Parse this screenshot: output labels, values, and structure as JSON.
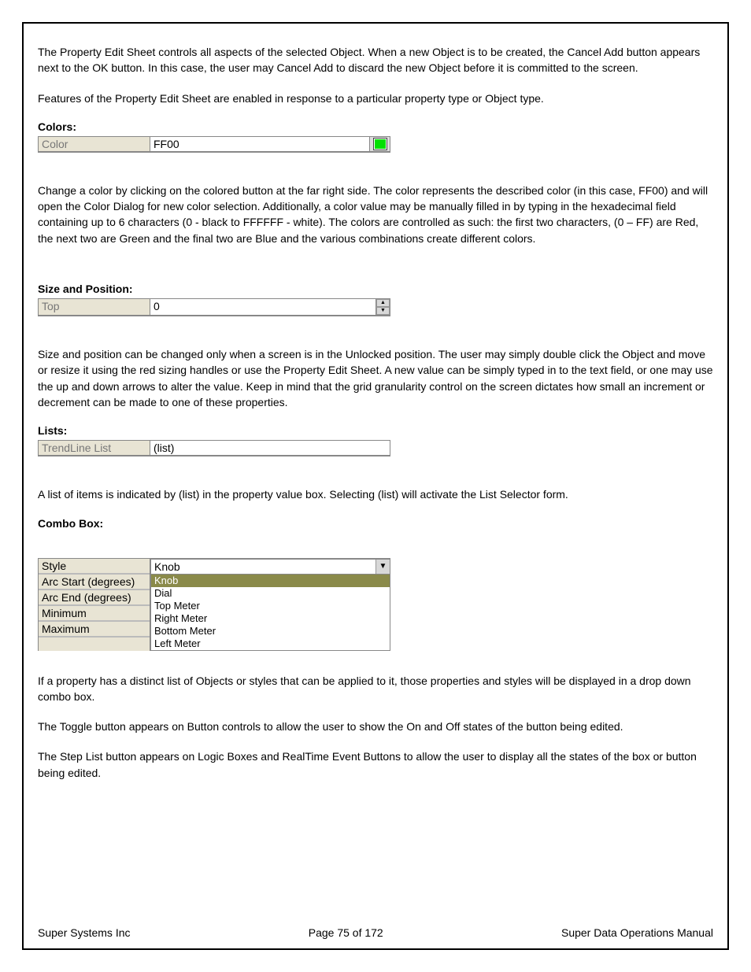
{
  "intro1": "The Property Edit Sheet controls all aspects of the selected Object.  When a new Object is to be created, the Cancel Add button appears next to the OK button.  In this case, the user may Cancel Add to discard the new Object before it is committed to the screen.",
  "intro2": "Features of the Property Edit Sheet are enabled in response to a particular property type or Object type.",
  "colors": {
    "heading": "Colors:",
    "label": "Color",
    "value": "FF00",
    "text": "Change a color by clicking on the colored button at the far right side.  The color represents the described color (in this case, FF00) and will open the Color Dialog for new color selection.  Additionally, a color value may be manually filled in by typing in the hexadecimal field containing up to 6 characters (0 - black to FFFFFF - white).  The colors are controlled as such: the first two characters, (0 – FF) are Red, the next two are Green and the final two are Blue and the various combinations create different colors."
  },
  "sizepos": {
    "heading": "Size and Position:",
    "label": "Top",
    "value": "0",
    "text": "Size and position can be changed only when a screen is in the Unlocked position.  The user may simply double click the Object and move or resize it using the red sizing handles or use the Property Edit Sheet.  A new value can be simply typed in to the text field, or one may use the up and down arrows to alter the value.  Keep in mind that the grid granularity control on the screen dictates how small an increment or decrement can be made to one of these properties."
  },
  "lists": {
    "heading": "Lists:",
    "label": "TrendLine List",
    "value": "(list)",
    "text": "A list of items is indicated by (list) in the property value box.  Selecting (list) will activate the List Selector form."
  },
  "combo": {
    "heading": "Combo Box:",
    "left_rows": [
      "Style",
      "Arc Start (degrees)",
      "Arc End (degrees)",
      "Minimum",
      "Maximum"
    ],
    "selected": "Knob",
    "options": [
      "Knob",
      "Dial",
      "Top Meter",
      "Right Meter",
      "Bottom Meter",
      "Left Meter"
    ],
    "text1": "If a property has a distinct list of Objects or styles that can be applied to it, those properties and styles will be displayed in a drop down combo box.",
    "text2": "The Toggle button appears on Button controls to allow the user to show the On and Off states of the button being edited.",
    "text3": "The Step List button appears on Logic Boxes and RealTime Event Buttons to allow the user to display all the states of the box or button being edited."
  },
  "footer": {
    "left": "Super Systems Inc",
    "center": "Page 75 of 172",
    "right": "Super Data Operations Manual"
  }
}
